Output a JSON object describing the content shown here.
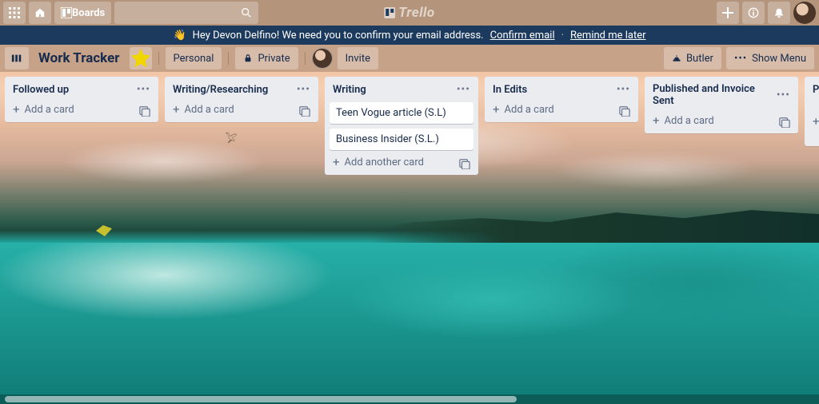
{
  "topbar": {
    "boards_label": "Boards",
    "logo_text": "Trello"
  },
  "banner": {
    "wave": "👋",
    "message": "Hey Devon Delfino! We need you to confirm your email address.",
    "confirm": "Confirm email",
    "remind": "Remind me later"
  },
  "board_header": {
    "title": "Work Tracker",
    "personal": "Personal",
    "private": "Private",
    "invite": "Invite",
    "butler": "Butler",
    "show_menu": "Show Menu"
  },
  "labels": {
    "add_card": "Add a card",
    "add_another_card": "Add another card"
  },
  "lists": [
    {
      "title": "Followed up",
      "cards": []
    },
    {
      "title": "Writing/Researching",
      "cards": []
    },
    {
      "title": "Writing",
      "cards": [
        "Teen Vogue article (S.L)",
        "Business Insider (S.L.)"
      ]
    },
    {
      "title": "In Edits",
      "cards": []
    },
    {
      "title": "Published and Invoice Sent",
      "cards": []
    },
    {
      "title": "Pa",
      "cards": []
    }
  ]
}
